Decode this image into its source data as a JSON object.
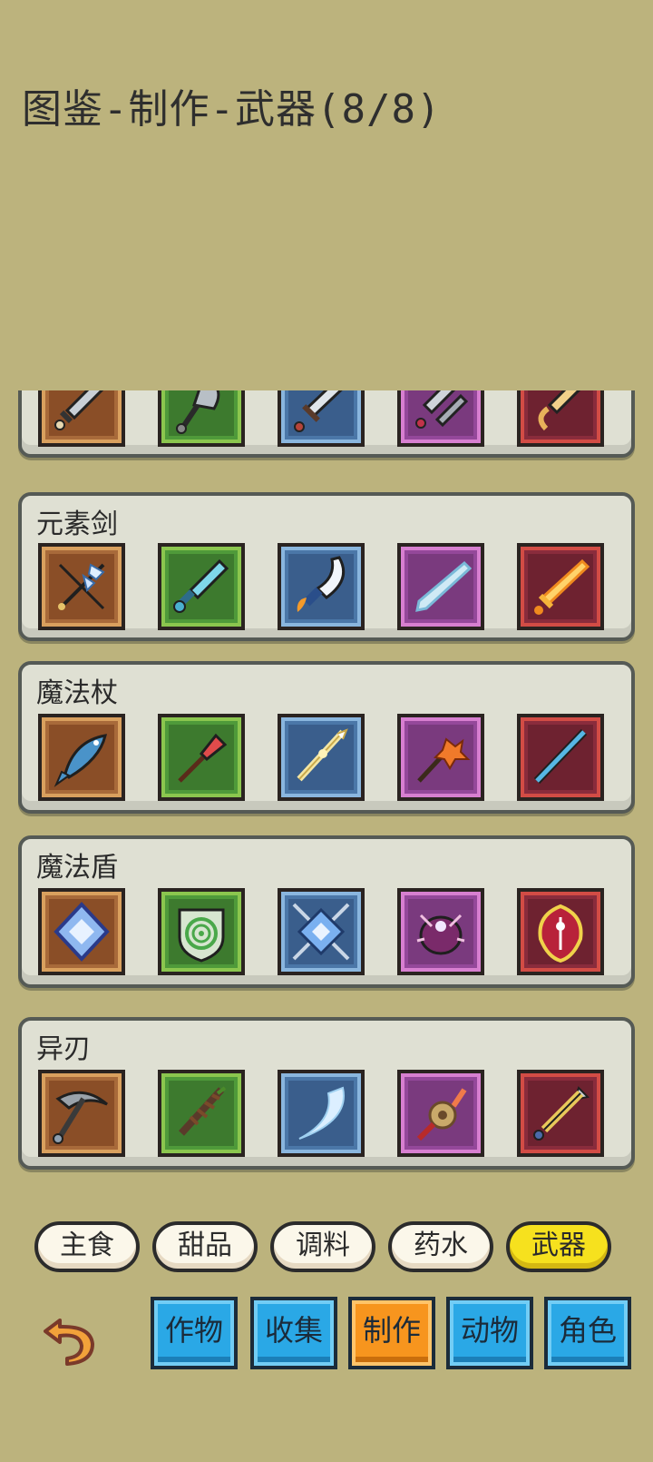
{
  "header": {
    "title": "图鉴-制作-武器(8/8)"
  },
  "panels": [
    {
      "label": "",
      "icons": [
        "dagger-icon",
        "axe-blade-icon",
        "broadsword-icon",
        "twin-blades-icon",
        "golden-sword-icon"
      ]
    },
    {
      "label": "元素剑",
      "icons": [
        "crossed-ice-sword-icon",
        "crystal-sword-icon",
        "flame-scimitar-icon",
        "ice-shard-sword-icon",
        "fire-sword-icon"
      ]
    },
    {
      "label": "魔法杖",
      "icons": [
        "fish-staff-icon",
        "red-crystal-staff-icon",
        "golden-staff-icon",
        "flower-staff-icon",
        "blue-rod-icon"
      ]
    },
    {
      "label": "魔法盾",
      "icons": [
        "diamond-shield-icon",
        "spiral-shield-icon",
        "crossed-shield-icon",
        "beetle-shield-icon",
        "red-beetle-shield-icon"
      ]
    },
    {
      "label": "异刃",
      "icons": [
        "pickaxe-icon",
        "vine-blade-icon",
        "crescent-blade-icon",
        "gear-blade-icon",
        "golden-hilt-icon"
      ]
    }
  ],
  "categories": [
    {
      "label": "主食",
      "active": false
    },
    {
      "label": "甜品",
      "active": false
    },
    {
      "label": "调料",
      "active": false
    },
    {
      "label": "药水",
      "active": false
    },
    {
      "label": "武器",
      "active": true
    }
  ],
  "nav": [
    {
      "label": "作物",
      "active": false
    },
    {
      "label": "收集",
      "active": false
    },
    {
      "label": "制作",
      "active": true
    },
    {
      "label": "动物",
      "active": false
    },
    {
      "label": "角色",
      "active": false
    }
  ],
  "colors": {
    "background": "#bcb37d",
    "category_active": "#f6e11e",
    "nav_default": "#2aa8e6",
    "nav_active": "#f7951e"
  }
}
